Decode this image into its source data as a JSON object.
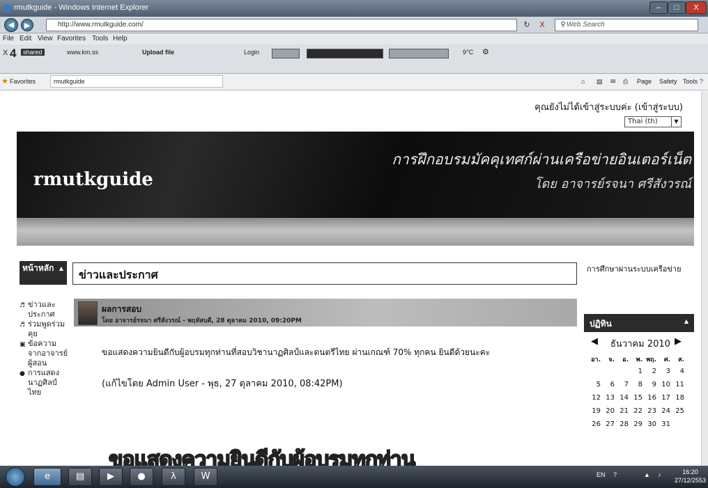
{
  "window": {
    "title": "rmutkguide - Windows Internet Explorer",
    "min": "–",
    "max": "□",
    "close": "X"
  },
  "address_bar": {
    "back": "◀",
    "forward": "▶",
    "url": "http://www.rmutkguide.com/",
    "refresh": "↻",
    "stop": "X",
    "search_placeholder": "Web Search",
    "search_icon": "search-icon"
  },
  "menu": {
    "file": "File",
    "edit": "Edit",
    "view": "View",
    "favorites": "Favorites",
    "tools": "Tools",
    "help": "Help"
  },
  "command_bar": {
    "close": "X",
    "count": "4",
    "shared": "shared",
    "site": "www.km.ss",
    "upload": "Upload file",
    "login": "Login",
    "temp": "9°C"
  },
  "favorites_bar": {
    "favorites": "Favorites",
    "tab": "rmutkguide",
    "page": "Page",
    "safety": "Safety",
    "tools": "Tools"
  },
  "page": {
    "login_status": "คุณยังไม่ได้เข้าสู่ระบบค่ะ (เข้าสู่ระบบ)",
    "language": "Thai (th)",
    "site_name": "rmutkguide",
    "banner_title": "การฝึกอบรมมัคคุเทศก์ผ่านเครือข่ายอินเตอร์เน็ต",
    "banner_author": "โดย  อาจารย์รจนา ศรีสังวรณ์",
    "left_block_title": "หน้าหลัก",
    "left_menu": [
      "ข่าวและประกาศ",
      "ร่วมพูดร่วมคุย",
      "ข้อความจากอาจารย์ผู้สอน",
      "การแสดงนาฏศิลป์ไทย"
    ],
    "section_title": "ข่าวและประกาศ",
    "post_title": "ผลการสอบ",
    "post_meta": "โดย อาจารย์รจนา ศรีสังวรณ์ - พฤหัสบดี, 28 ตุลาคม 2010, 09:20PM",
    "post_body": "ขอแสดงความยินดีกับผู้อบรมทุกท่านที่สอบวิชานาฏศิลป์และดนตรีไทย  ผ่านเกณฑ์ 70% ทุกคน ยินดีด้วยนะคะ",
    "post_edit": "(แก้ไขโดย Admin User - พุธ, 27 ตุลาคม 2010, 08:42PM)",
    "big_text": "ขอแสดงความยินดีกับผู้อบรมทุกท่าน",
    "right_link": "การศึกษาผ่านระบบเครือข่าย",
    "calendar_title": "ปฏิทิน",
    "calendar_month": "ธันวาคม 2010",
    "calendar_prev": "◀",
    "calendar_next": "▶",
    "calendar_weekdays": [
      "อา.",
      "จ.",
      "อ.",
      "พ.",
      "พฤ.",
      "ศ.",
      "ส."
    ],
    "calendar_weeks": [
      [
        "",
        "",
        "",
        "1",
        "2",
        "3",
        "4"
      ],
      [
        "5",
        "6",
        "7",
        "8",
        "9",
        "10",
        "11"
      ],
      [
        "12",
        "13",
        "14",
        "15",
        "16",
        "17",
        "18"
      ],
      [
        "19",
        "20",
        "21",
        "22",
        "23",
        "24",
        "25"
      ],
      [
        "26",
        "27",
        "28",
        "29",
        "30",
        "31",
        ""
      ]
    ]
  },
  "taskbar": {
    "lang": "EN",
    "time": "16:20",
    "date": "27/12/2553"
  }
}
